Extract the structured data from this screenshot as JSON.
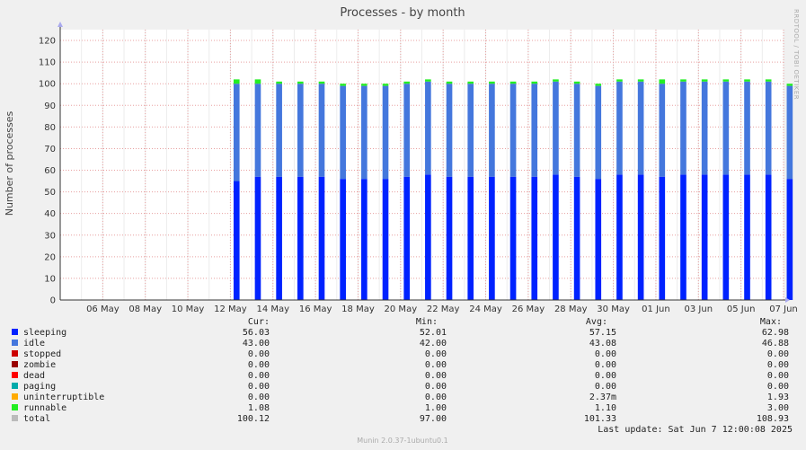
{
  "chart_data": {
    "type": "area",
    "title": "Processes - by month",
    "ylabel": "Number of processes",
    "ylim": [
      0,
      125
    ],
    "yticks": [
      0,
      10,
      20,
      30,
      40,
      50,
      60,
      70,
      80,
      90,
      100,
      110,
      120
    ],
    "x_start": "2025-05-04",
    "x_end": "2025-06-07",
    "xticks": [
      "06 May",
      "08 May",
      "10 May",
      "12 May",
      "14 May",
      "16 May",
      "18 May",
      "20 May",
      "22 May",
      "24 May",
      "26 May",
      "28 May",
      "30 May",
      "01 Jun",
      "03 Jun",
      "05 Jun",
      "07 Jun"
    ],
    "grid": true,
    "side_label": "RRDTOOL / TOBI OETIKER",
    "bursts": [
      {
        "x": "2025-05-12",
        "sleeping": 55,
        "idle": 45,
        "runnable": 2
      },
      {
        "x": "2025-05-13",
        "sleeping": 57,
        "idle": 43,
        "runnable": 2
      },
      {
        "x": "2025-05-14",
        "sleeping": 57,
        "idle": 43,
        "runnable": 1
      },
      {
        "x": "2025-05-15",
        "sleeping": 57,
        "idle": 43,
        "runnable": 1
      },
      {
        "x": "2025-05-16",
        "sleeping": 57,
        "idle": 43,
        "runnable": 1
      },
      {
        "x": "2025-05-17",
        "sleeping": 56,
        "idle": 43,
        "runnable": 1
      },
      {
        "x": "2025-05-18",
        "sleeping": 56,
        "idle": 43,
        "runnable": 1
      },
      {
        "x": "2025-05-19",
        "sleeping": 56,
        "idle": 43,
        "runnable": 1
      },
      {
        "x": "2025-05-20",
        "sleeping": 57,
        "idle": 43,
        "runnable": 1
      },
      {
        "x": "2025-05-21",
        "sleeping": 58,
        "idle": 43,
        "runnable": 1
      },
      {
        "x": "2025-05-22",
        "sleeping": 57,
        "idle": 43,
        "runnable": 1
      },
      {
        "x": "2025-05-23",
        "sleeping": 57,
        "idle": 43,
        "runnable": 1
      },
      {
        "x": "2025-05-24",
        "sleeping": 57,
        "idle": 43,
        "runnable": 1
      },
      {
        "x": "2025-05-25",
        "sleeping": 57,
        "idle": 43,
        "runnable": 1
      },
      {
        "x": "2025-05-26",
        "sleeping": 57,
        "idle": 43,
        "runnable": 1
      },
      {
        "x": "2025-05-27",
        "sleeping": 58,
        "idle": 43,
        "runnable": 1
      },
      {
        "x": "2025-05-28",
        "sleeping": 57,
        "idle": 43,
        "runnable": 1
      },
      {
        "x": "2025-05-29",
        "sleeping": 56,
        "idle": 43,
        "runnable": 1
      },
      {
        "x": "2025-05-30",
        "sleeping": 58,
        "idle": 43,
        "runnable": 1
      },
      {
        "x": "2025-05-31",
        "sleeping": 58,
        "idle": 43,
        "runnable": 1
      },
      {
        "x": "2025-06-01",
        "sleeping": 57,
        "idle": 43,
        "runnable": 2
      },
      {
        "x": "2025-06-02",
        "sleeping": 58,
        "idle": 43,
        "runnable": 1
      },
      {
        "x": "2025-06-03",
        "sleeping": 58,
        "idle": 43,
        "runnable": 1
      },
      {
        "x": "2025-06-04",
        "sleeping": 58,
        "idle": 43,
        "runnable": 1
      },
      {
        "x": "2025-06-05",
        "sleeping": 58,
        "idle": 43,
        "runnable": 1
      },
      {
        "x": "2025-06-06",
        "sleeping": 58,
        "idle": 43,
        "runnable": 1
      },
      {
        "x": "2025-06-07",
        "sleeping": 56,
        "idle": 43,
        "runnable": 1
      }
    ],
    "legend": {
      "headers": [
        "Cur:",
        "Min:",
        "Avg:",
        "Max:"
      ],
      "rows": [
        {
          "name": "sleeping",
          "color": "#0022ff",
          "cur": "56.03",
          "min": "52.01",
          "avg": "57.15",
          "max": "62.98"
        },
        {
          "name": "idle",
          "color": "#4477dd",
          "cur": "43.00",
          "min": "42.00",
          "avg": "43.08",
          "max": "46.88"
        },
        {
          "name": "stopped",
          "color": "#cc0000",
          "cur": "0.00",
          "min": "0.00",
          "avg": "0.00",
          "max": "0.00"
        },
        {
          "name": "zombie",
          "color": "#990000",
          "cur": "0.00",
          "min": "0.00",
          "avg": "0.00",
          "max": "0.00"
        },
        {
          "name": "dead",
          "color": "#ff0000",
          "cur": "0.00",
          "min": "0.00",
          "avg": "0.00",
          "max": "0.00"
        },
        {
          "name": "paging",
          "color": "#00aaaa",
          "cur": "0.00",
          "min": "0.00",
          "avg": "0.00",
          "max": "0.00"
        },
        {
          "name": "uninterruptible",
          "color": "#ffaa00",
          "cur": "0.00",
          "min": "0.00",
          "avg": "2.37m",
          "max": "1.93"
        },
        {
          "name": "runnable",
          "color": "#22ee22",
          "cur": "1.08",
          "min": "1.00",
          "avg": "1.10",
          "max": "3.00"
        },
        {
          "name": "total",
          "color": "#bbbbbb",
          "cur": "100.12",
          "min": "97.00",
          "avg": "101.33",
          "max": "108.93"
        }
      ]
    },
    "last_update": "Last update: Sat Jun  7 12:00:08 2025",
    "footer": "Munin 2.0.37-1ubuntu0.1"
  }
}
